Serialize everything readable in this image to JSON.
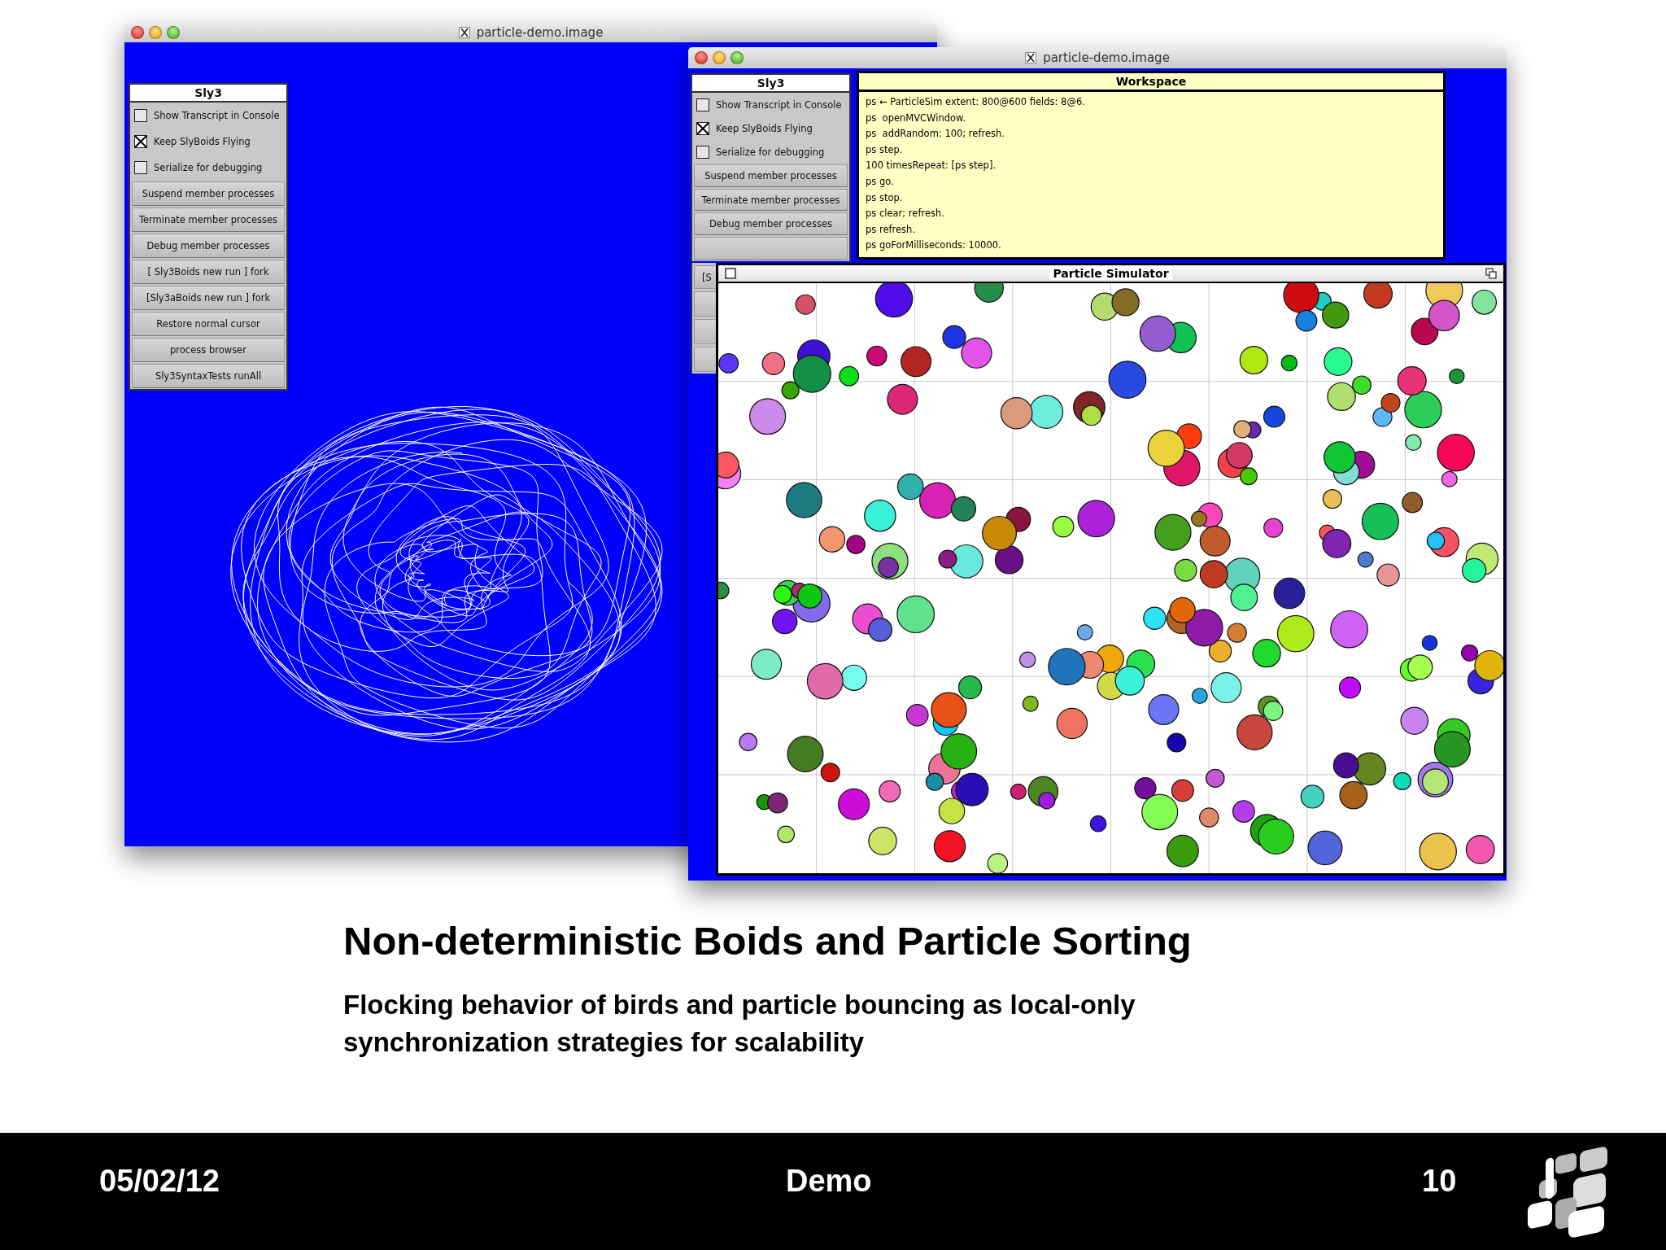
{
  "windows": [
    {
      "title": "particle-demo.image",
      "panel": {
        "title": "Sly3",
        "options": [
          {
            "label": "Show Transcript in Console",
            "checked": false
          },
          {
            "label": "Keep SlyBoids Flying",
            "checked": true
          },
          {
            "label": "Serialize for debugging",
            "checked": false
          }
        ],
        "buttons": [
          "Suspend member processes",
          "Terminate member processes",
          "Debug member processes",
          "[ Sly3Boids new run ] fork",
          "[Sly3aBoids new run ] fork",
          "Restore normal cursor",
          "process browser",
          "Sly3SyntaxTests runAll"
        ]
      }
    },
    {
      "title": "particle-demo.image",
      "panel": {
        "title": "Sly3",
        "options": [
          {
            "label": "Show Transcript in Console",
            "checked": false
          },
          {
            "label": "Keep SlyBoids Flying",
            "checked": true
          },
          {
            "label": "Serialize for debugging",
            "checked": false
          }
        ],
        "buttons": [
          "Suspend member processes",
          "Terminate member processes",
          "Debug member processes",
          "[S"
        ]
      },
      "workspace": {
        "title": "Workspace",
        "lines": [
          "ps ← ParticleSim extent: 800@600 fields: 8@6.",
          "ps  openMVCWindow.",
          "ps  addRandom: 100; refresh.",
          "ps step.",
          "100 timesRepeat: [ps step].",
          "ps go.",
          "ps stop.",
          "ps clear; refresh.",
          "ps refresh.",
          "ps goForMilliseconds: 10000."
        ]
      },
      "simulator": {
        "title": "Particle Simulator"
      }
    }
  ],
  "heading": "Non-deterministic Boids and Particle Sorting",
  "subheading": "Flocking behavior of birds and particle bouncing as local-only synchronization strategies for scalability",
  "footer": {
    "date": "05/02/12",
    "section": "Demo",
    "page": "10"
  }
}
